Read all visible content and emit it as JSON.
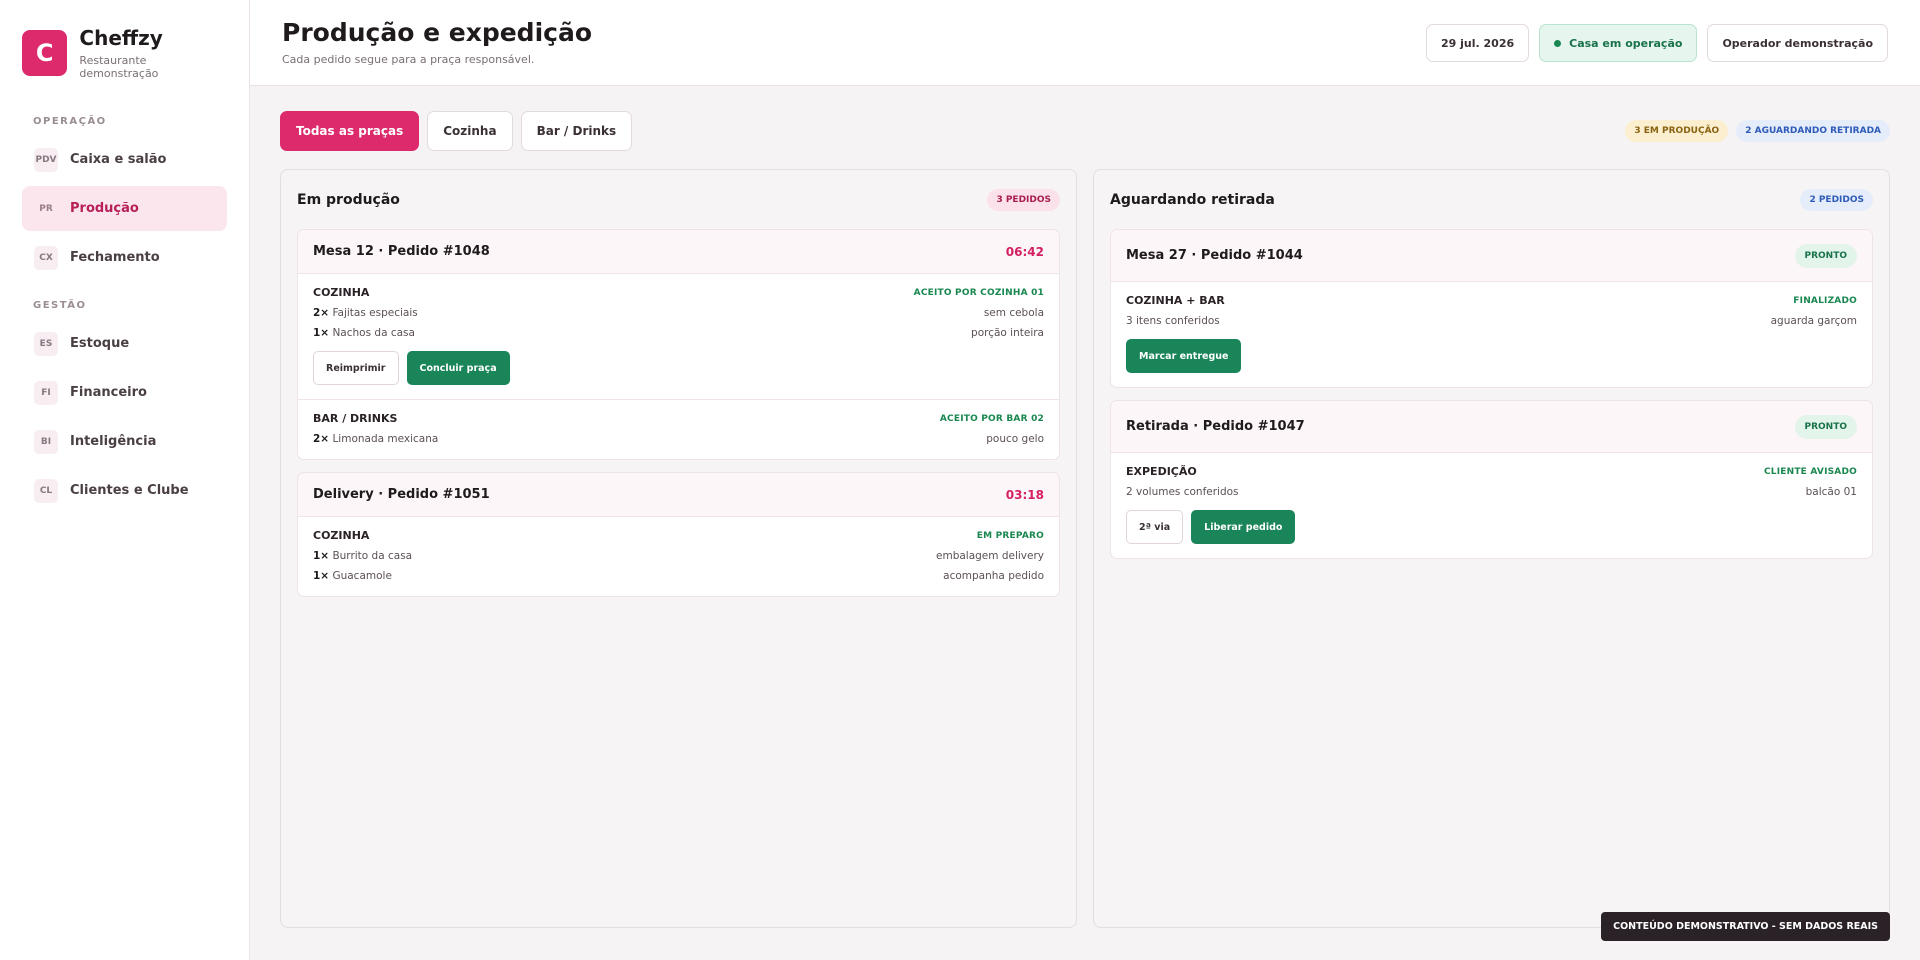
{
  "brand": {
    "logo_letter": "C",
    "name": "Cheffzy",
    "subtitle": "Restaurante demonstração"
  },
  "sidebar": {
    "sections": [
      {
        "title": "OPERAÇÃO",
        "items": [
          {
            "badge": "PDV",
            "label": "Caixa e salão",
            "active": false
          },
          {
            "badge": "PR",
            "label": "Produção",
            "active": true
          },
          {
            "badge": "CX",
            "label": "Fechamento",
            "active": false
          }
        ]
      },
      {
        "title": "GESTÃO",
        "items": [
          {
            "badge": "ES",
            "label": "Estoque",
            "active": false
          },
          {
            "badge": "FI",
            "label": "Financeiro",
            "active": false
          },
          {
            "badge": "BI",
            "label": "Inteligência",
            "active": false
          },
          {
            "badge": "CL",
            "label": "Clientes e Clube",
            "active": false
          }
        ]
      }
    ]
  },
  "header": {
    "title": "Produção e expedição",
    "subtitle": "Cada pedido segue para a praça responsável.",
    "date": "29 jul. 2026",
    "status": "Casa em operação",
    "operator": "Operador demonstração"
  },
  "filters": {
    "all": "Todas as praças",
    "kitchen": "Cozinha",
    "bar": "Bar / Drinks"
  },
  "summary": {
    "in_production": "3 EM PRODUÇÃO",
    "awaiting": "2 AGUARDANDO RETIRADA"
  },
  "columns": {
    "production": {
      "title": "Em produção",
      "count": "3 PEDIDOS",
      "orders": [
        {
          "title": "Mesa 12 · Pedido #1048",
          "timer": "06:42",
          "stations": [
            {
              "name": "COZINHA",
              "status": "ACEITO POR COZINHA 01",
              "items": [
                {
                  "qty": "2×",
                  "name": "Fajitas especiais",
                  "note": "sem cebola"
                },
                {
                  "qty": "1×",
                  "name": "Nachos da casa",
                  "note": "porção inteira"
                }
              ],
              "buttons": {
                "reprint": "Reimprimir",
                "complete": "Concluir praça"
              }
            },
            {
              "name": "BAR / DRINKS",
              "status": "ACEITO POR BAR 02",
              "items": [
                {
                  "qty": "2×",
                  "name": "Limonada mexicana",
                  "note": "pouco gelo"
                }
              ]
            }
          ]
        },
        {
          "title": "Delivery · Pedido #1051",
          "timer": "03:18",
          "stations": [
            {
              "name": "COZINHA",
              "status": "EM PREPARO",
              "items": [
                {
                  "qty": "1×",
                  "name": "Burrito da casa",
                  "note": "embalagem delivery"
                },
                {
                  "qty": "1×",
                  "name": "Guacamole",
                  "note": "acompanha pedido"
                }
              ]
            }
          ]
        }
      ]
    },
    "pickup": {
      "title": "Aguardando retirada",
      "count": "2 PEDIDOS",
      "orders": [
        {
          "title": "Mesa 27 · Pedido #1044",
          "badge": "PRONTO",
          "station": "COZINHA + BAR",
          "status": "FINALIZADO",
          "detail": "3 itens conferidos",
          "note": "aguarda garçom",
          "buttons": {
            "deliver": "Marcar entregue"
          }
        },
        {
          "title": "Retirada · Pedido #1047",
          "badge": "PRONTO",
          "station": "EXPEDIÇÃO",
          "status": "CLIENTE AVISADO",
          "detail": "2 volumes conferidos",
          "note": "balcão 01",
          "buttons": {
            "copy": "2ª via",
            "release": "Liberar pedido"
          }
        }
      ]
    }
  },
  "footer_notice": "CONTEÚDO DEMONSTRATIVO - SEM DADOS REAIS",
  "colors": {
    "brand": "#dc2a6c",
    "success": "#1a8559",
    "timer": "#d41f63"
  }
}
